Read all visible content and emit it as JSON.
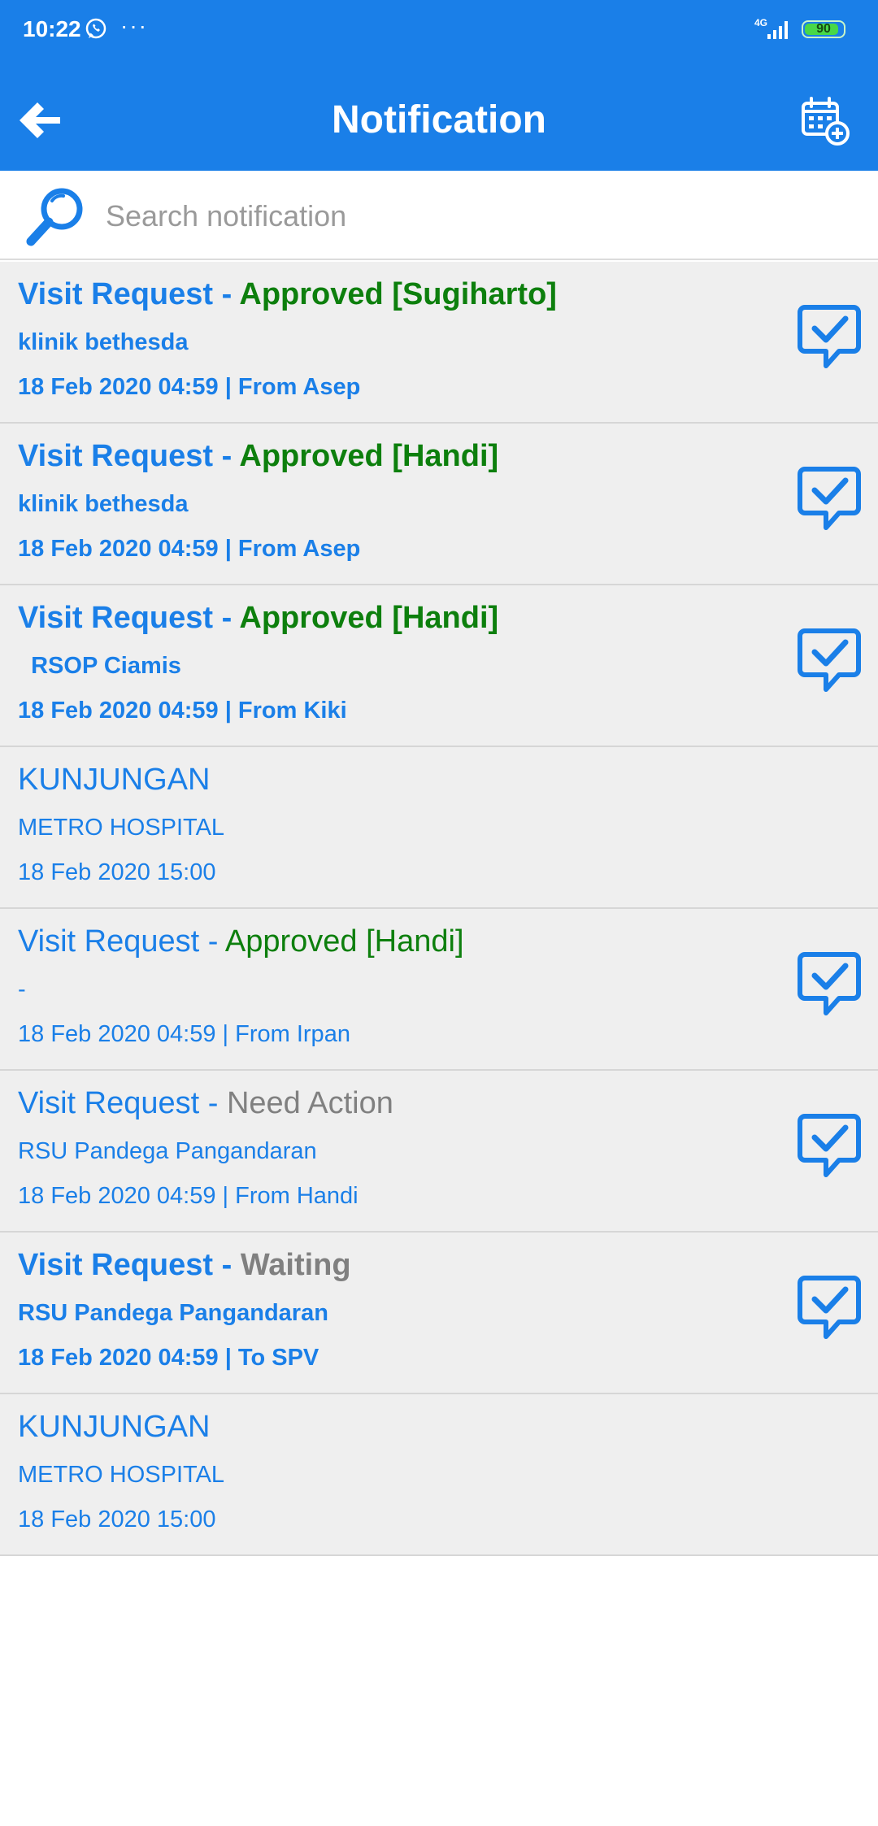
{
  "status_bar": {
    "time": "10:22",
    "dots": "···",
    "network": "4G",
    "battery": "90",
    "battery_level": 0.9
  },
  "header": {
    "title": "Notification",
    "back_icon": "arrow-left-icon",
    "action_icon": "calendar-add-icon"
  },
  "search": {
    "placeholder": "Search notification",
    "value": ""
  },
  "colors": {
    "primary": "#1a7fe8",
    "approved": "#0d7f0d",
    "neutral": "#808080",
    "row_bg": "#efefef"
  },
  "notifications": [
    {
      "prefix": "Visit Request - ",
      "status": "Approved [Sugiharto]",
      "status_color": "green",
      "subtitle": "klinik bethesda",
      "meta": "18 Feb 2020 04:59 | From Asep",
      "bold": true,
      "has_check": true
    },
    {
      "prefix": "Visit Request - ",
      "status": "Approved [Handi]",
      "status_color": "green",
      "subtitle": "klinik bethesda",
      "meta": "18 Feb 2020 04:59 | From Asep",
      "bold": true,
      "has_check": true
    },
    {
      "prefix": "Visit Request - ",
      "status": "Approved [Handi]",
      "status_color": "green",
      "subtitle": "  RSOP Ciamis",
      "meta": "18 Feb 2020 04:59 | From Kiki",
      "bold": true,
      "has_check": true
    },
    {
      "prefix": "KUNJUNGAN",
      "status": "",
      "status_color": "green",
      "subtitle": "METRO HOSPITAL",
      "meta": "18 Feb 2020 15:00",
      "bold": false,
      "has_check": false
    },
    {
      "prefix": "Visit Request - ",
      "status": "Approved [Handi]",
      "status_color": "green",
      "subtitle": "-",
      "meta": "18 Feb 2020 04:59 | From Irpan",
      "bold": false,
      "has_check": true
    },
    {
      "prefix": "Visit Request - ",
      "status": "Need Action",
      "status_color": "gray",
      "subtitle": "RSU Pandega Pangandaran",
      "meta": "18 Feb 2020 04:59 | From Handi",
      "bold": false,
      "has_check": true
    },
    {
      "prefix": "Visit Request - ",
      "status": "Waiting",
      "status_color": "gray",
      "subtitle": "RSU Pandega Pangandaran",
      "meta": "18 Feb 2020 04:59 | To SPV",
      "bold": true,
      "has_check": true
    },
    {
      "prefix": "KUNJUNGAN",
      "status": "",
      "status_color": "green",
      "subtitle": "METRO HOSPITAL",
      "meta": "18 Feb 2020 15:00",
      "bold": false,
      "has_check": false
    }
  ]
}
